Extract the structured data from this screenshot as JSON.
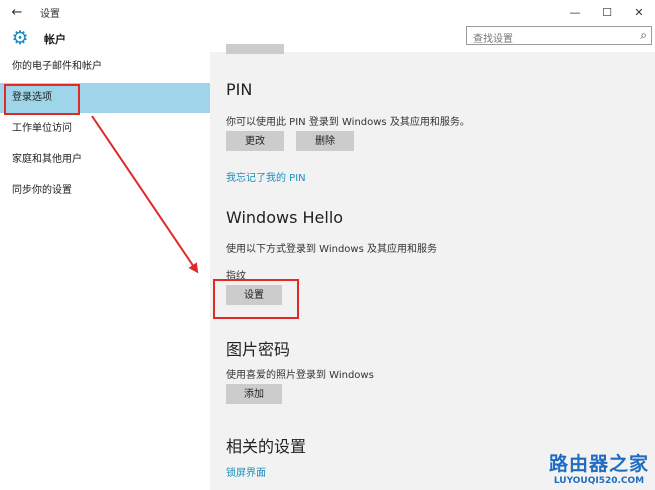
{
  "titlebar": {
    "back_icon": "←",
    "title": "设置",
    "minimize_icon": "—",
    "maximize_icon": "☐",
    "close_icon": "✕"
  },
  "header": {
    "gear_icon": "⚙",
    "title": "帐户",
    "search_placeholder": "查找设置",
    "search_icon": "⌕"
  },
  "sidebar": {
    "items": [
      {
        "label": "你的电子邮件和帐户",
        "active": false
      },
      {
        "label": "登录选项",
        "active": true
      },
      {
        "label": "工作单位访问",
        "active": false
      },
      {
        "label": "家庭和其他用户",
        "active": false
      },
      {
        "label": "同步你的设置",
        "active": false
      }
    ]
  },
  "main": {
    "pin": {
      "heading": "PIN",
      "description": "你可以使用此 PIN 登录到 Windows 及其应用和服务。",
      "change_button": "更改",
      "delete_button": "删除",
      "forgot_link": "我忘记了我的 PIN"
    },
    "hello": {
      "heading": "Windows Hello",
      "description": "使用以下方式登录到 Windows 及其应用和服务",
      "fingerprint_label": "指纹",
      "setup_button": "设置"
    },
    "picture_password": {
      "heading": "图片密码",
      "description": "使用喜爱的照片登录到 Windows",
      "add_button": "添加"
    },
    "related": {
      "heading": "相关的设置",
      "lock_screen_link": "锁屏界面"
    }
  },
  "annotation": {
    "color": "#e02a2a"
  },
  "watermark": {
    "text_cn": "路由器之家",
    "text_en": "LUYOUQI520.COM"
  },
  "colors": {
    "accent": "#1a8fbf",
    "sidebar_active": "#9fd5e8",
    "content_bg": "#f2f2f2",
    "button_bg": "#cccccc"
  }
}
